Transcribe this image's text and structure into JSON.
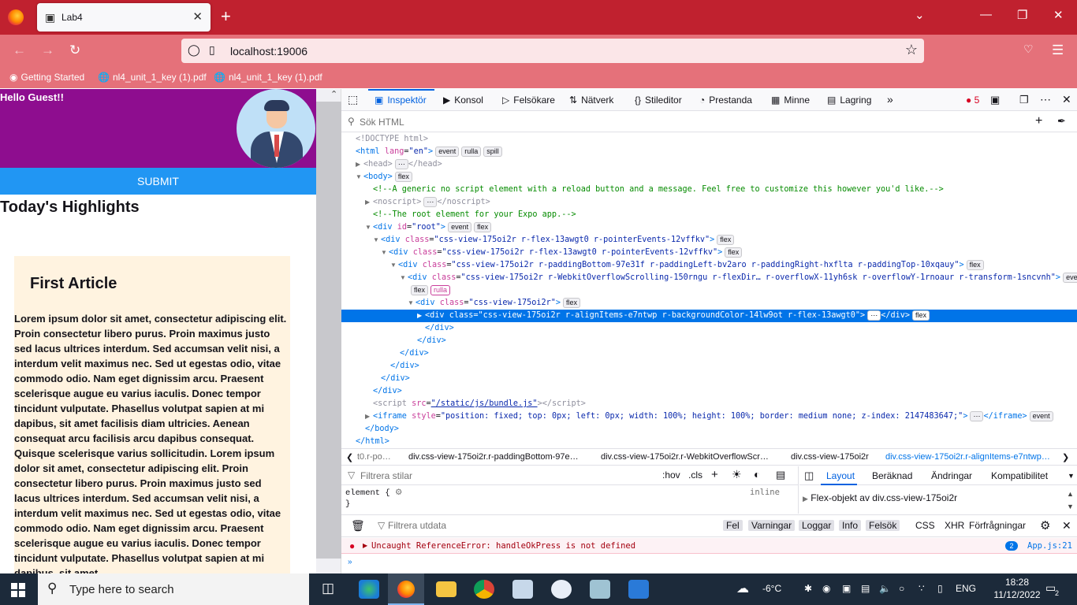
{
  "browser": {
    "tab_title": "Lab4",
    "url": "localhost:19006",
    "bookmarks": [
      "Getting Started",
      "nl4_unit_1_key (1).pdf",
      "nl4_unit_1_key (1).pdf"
    ]
  },
  "app": {
    "greeting": "Hello Guest!!",
    "submit_label": "SUBMIT",
    "section_title": "Today's Highlights",
    "article_title": "First Article",
    "article_body": "Lorem ipsum dolor sit amet, consectetur adipiscing elit. Proin consectetur libero purus. Proin maximus justo sed lacus ultrices interdum. Sed accumsan velit nisi, a interdum velit maximus nec. Sed ut egestas odio, vitae commodo odio. Nam eget dignissim arcu. Praesent scelerisque augue eu varius iaculis. Donec tempor tincidunt vulputate. Phasellus volutpat sapien at mi dapibus, sit amet facilisis diam ultricies. Aenean consequat arcu facilisis arcu dapibus consequat. Quisque scelerisque varius sollicitudin. Lorem ipsum dolor sit amet, consectetur adipiscing elit. Proin consectetur libero purus. Proin maximus justo sed lacus ultrices interdum. Sed accumsan velit nisi, a interdum velit maximus nec. Sed ut egestas odio, vitae commodo odio. Nam eget dignissim arcu. Praesent scelerisque augue eu varius iaculis. Donec tempor tincidunt vulputate. Phasellus volutpat sapien at mi dapibus, sit amet",
    "colors": {
      "banner": "#8e0d8f",
      "submit": "#2196f3",
      "card": "#fff3e0"
    }
  },
  "devtools": {
    "tabs": [
      "Inspektör",
      "Konsol",
      "Felsökare",
      "Nätverk",
      "Stileditor",
      "Prestanda",
      "Minne",
      "Lagring"
    ],
    "error_count": "5",
    "search_placeholder": "Sök HTML",
    "markup": {
      "doctype": "<!DOCTYPE html>",
      "html_open": "<html",
      "html_lang_attr": "lang",
      "html_lang_val": "\"en\"",
      "head": "<head>",
      "head_close": "</head>",
      "body_open": "<body>",
      "comment1": "<!--A generic no script element with a reload button and a message. Feel free to customize this however you'd like.-->",
      "noscript": "<noscript>",
      "noscript_close": "</noscript>",
      "comment2": "<!--The root element for your Expo app.-->",
      "root_div": "<div",
      "root_id_attr": "id",
      "root_id_val": "\"root\"",
      "div1_class": "\"css-view-175oi2r r-flex-13awgt0 r-pointerEvents-12vffkv\"",
      "div2_class": "\"css-view-175oi2r r-flex-13awgt0 r-pointerEvents-12vffkv\"",
      "div3_class": "\"css-view-175oi2r r-paddingBottom-97e31f r-paddingLeft-bv2aro r-paddingRight-hxflta r-paddingTop-10xqauy\"",
      "div4_class": "\"css-view-175oi2r r-WebkitOverflowScrolling-150rngu r-flexDir… r-overflowX-11yh6sk r-overflowY-1rnoaur r-transform-1sncvnh\"",
      "div5_class": "\"css-view-175oi2r\"",
      "div6_class": "\"css-view-175oi2r r-alignItems-e7ntwp r-backgroundColor-14lw9ot r-flex-13awgt0\"",
      "div_close": "</div>",
      "body_close": "</body>",
      "html_close": "</html>",
      "script_src": "\"/static/js/bundle.js\"",
      "iframe_style": "\"position: fixed; top: 0px; left: 0px; width: 100%; height: 100%; border: medium none; z-index: 2147483647;\"",
      "class_attr": "class",
      "style_attr": "style",
      "src_attr": "src",
      "badges": {
        "event": "event",
        "rulla": "rulla",
        "spill": "spill",
        "flex": "flex"
      }
    },
    "breadcrumbs": [
      "t0.r-po…",
      "div.css-view-175oi2r.r-paddingBottom-97e…",
      "div.css-view-175oi2r.r-WebkitOverflowScr…",
      "div.css-view-175oi2r",
      "div.css-view-175oi2r.r-alignItems-e7ntwp…"
    ],
    "rules": {
      "filter_placeholder": "Filtrera stilar",
      "hov": ":hov",
      "cls": ".cls",
      "element_rule": "element {",
      "close": "}",
      "inline": "inline"
    },
    "layout_tabs": [
      "Layout",
      "Beräknad",
      "Ändringar",
      "Kompatibilitet"
    ],
    "flex_object": "Flex-objekt av div.css-view-175oi2r",
    "console": {
      "filter_placeholder": "Filtrera utdata",
      "levels": [
        "Fel",
        "Varningar",
        "Loggar",
        "Info",
        "Felsök"
      ],
      "types": [
        "CSS",
        "XHR",
        "Förfrågningar"
      ],
      "error_message": "Uncaught ReferenceError: handleOkPress is not defined",
      "error_count": "2",
      "error_source": "App.js:21"
    }
  },
  "taskbar": {
    "search_placeholder": "Type here to search",
    "weather": "-6°C",
    "language": "ENG",
    "time": "18:28",
    "date": "11/12/2022",
    "notifications": "2"
  }
}
